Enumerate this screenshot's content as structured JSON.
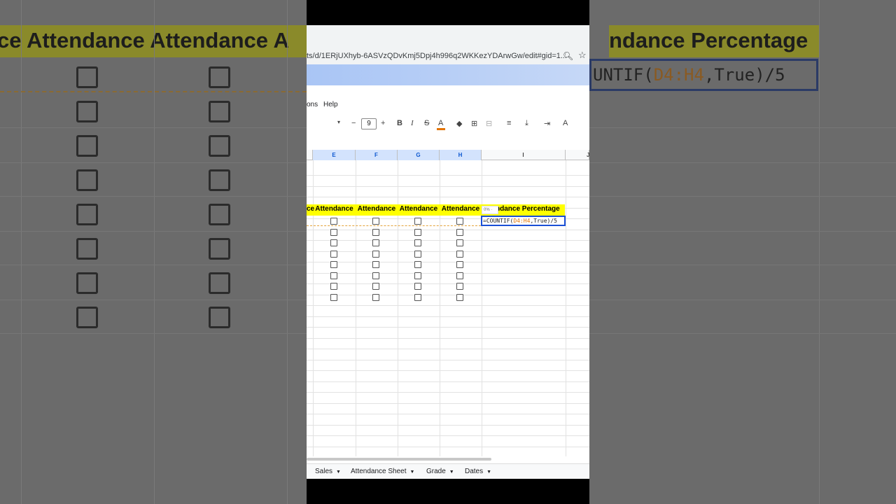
{
  "background": {
    "left_header": "ce  Attendance  Attendance  A",
    "right_header": "ndance Percentage",
    "right_formula_prefix": "UNTIF(",
    "right_formula_range": "D4:H4",
    "right_formula_suffix": ",True)/5"
  },
  "browser": {
    "url": "ts/d/1ERjUXhyb-6ASVzQDvKmj5Dpj4h996q2WKKezYDArwGw/edit#gid=1...",
    "search_icon": "search-icon",
    "star_icon": "star-icon"
  },
  "menu": {
    "items": [
      "ons",
      "Help"
    ]
  },
  "toolbar": {
    "font_size": "9",
    "minus": "−",
    "plus": "+",
    "bold": "B",
    "italic": "I",
    "strike": "S",
    "text_color": "A",
    "fill": "◆",
    "borders": "⊞",
    "merge": "⊟",
    "halign": "≡",
    "valign": "⤓",
    "wrap": "⇥",
    "rotate": "A"
  },
  "grid": {
    "columns": [
      "E",
      "F",
      "G",
      "H",
      "I",
      "J"
    ],
    "header_cells": [
      "ce",
      "Attendance",
      "Attendance",
      "Attendance",
      "Attendance",
      "ndance Percentage"
    ],
    "formula_prefix": "=COUNTIF(",
    "formula_range": "D4:H4",
    "formula_suffix": ",True)/5",
    "chip": "0% ·",
    "checkbox_rows": 8
  },
  "sheets": {
    "tabs": [
      "Sales",
      "Attendance Sheet",
      "Grade",
      "Dates"
    ]
  },
  "colors": {
    "header_fill": "#ffff00",
    "selection": "#1a4fd6",
    "range_highlight": "#e37400"
  }
}
